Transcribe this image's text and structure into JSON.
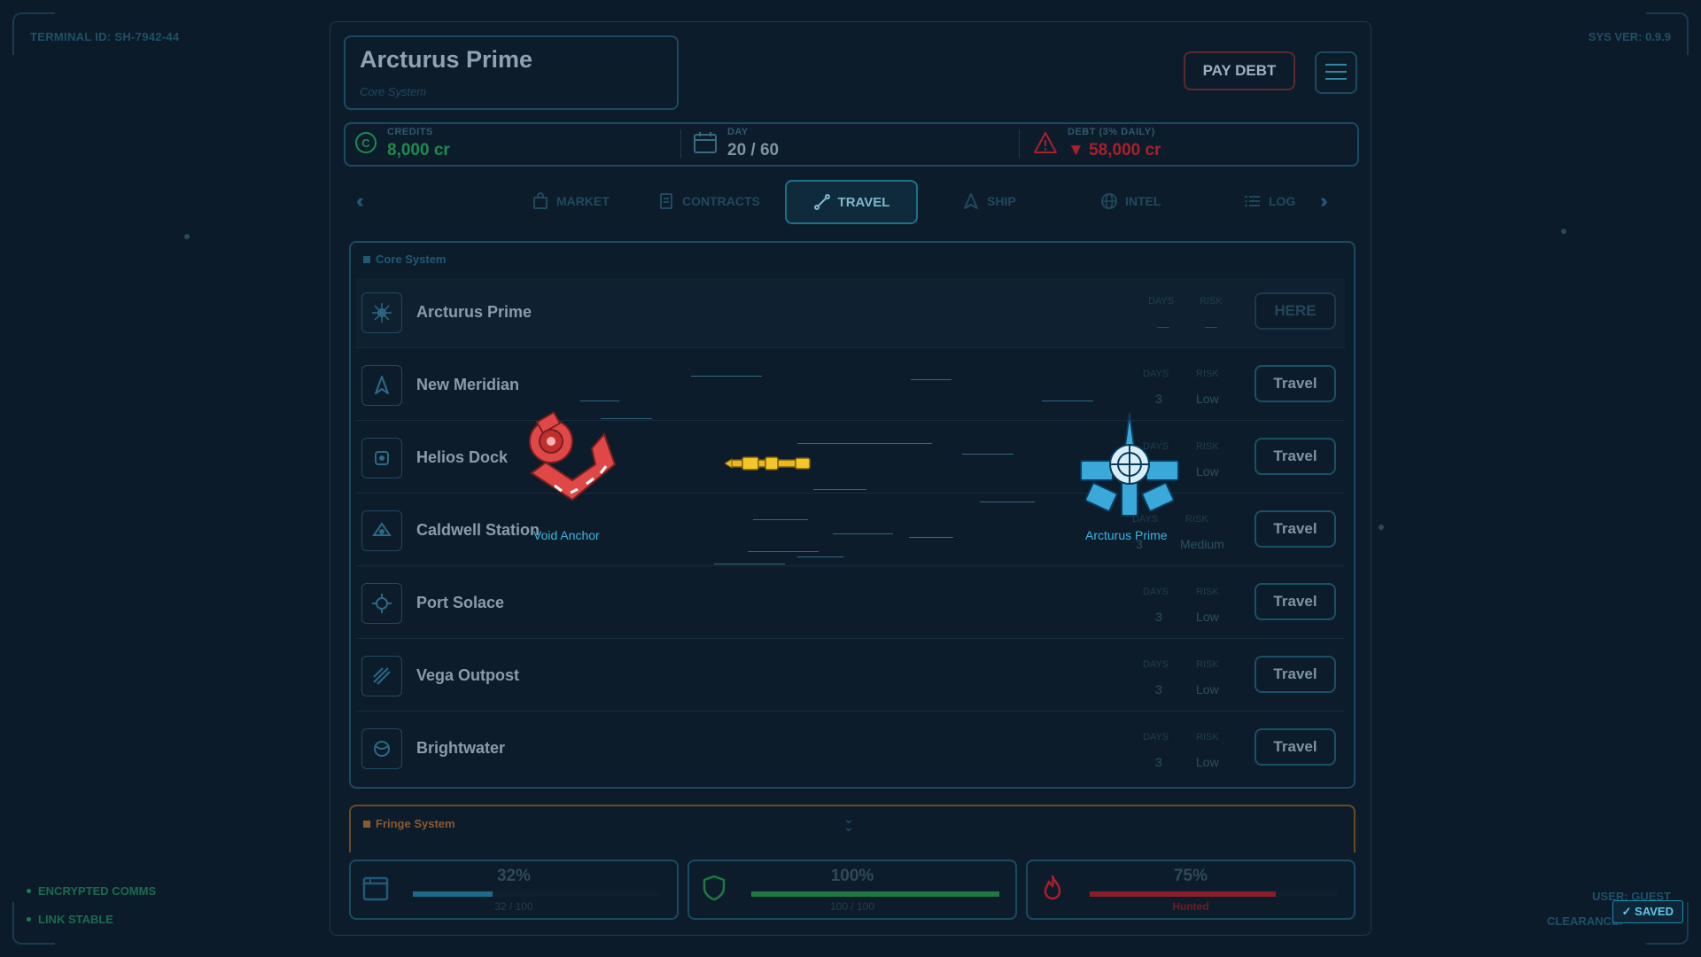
{
  "hud": {
    "terminal_id": "TERMINAL ID: SH-7942-44",
    "sys_ver": "SYS VER: 0.9.9",
    "status": [
      "ENCRYPTED COMMS",
      "LINK STABLE"
    ],
    "user": "USER: GUEST",
    "clearance": "CLEARANCE:",
    "saved": "✓ SAVED"
  },
  "header": {
    "location_name": "Arcturus Prime",
    "location_system": "Core System",
    "pay_debt": "PAY DEBT"
  },
  "stats": {
    "credits_label": "CREDITS",
    "credits_value": "8,000 cr",
    "day_label": "DAY",
    "day_value": "20 / 60",
    "debt_label": "DEBT (3% DAILY)",
    "debt_value": "▼ 58,000 cr"
  },
  "tabs": {
    "market": "MARKET",
    "contracts": "CONTRACTS",
    "travel": "TRAVEL",
    "ship": "SHIP",
    "intel": "INTEL",
    "log": "LOG",
    "active": "travel"
  },
  "core_system": {
    "title": "Core System",
    "days_label": "DAYS",
    "risk_label": "RISK",
    "destinations": [
      {
        "name": "Arcturus Prime",
        "days": "—",
        "risk": "—",
        "action": "HERE"
      },
      {
        "name": "New Meridian",
        "days": "3",
        "risk": "Low",
        "action": "Travel"
      },
      {
        "name": "Helios Dock",
        "days": "3",
        "risk": "Low",
        "action": "Travel"
      },
      {
        "name": "Caldwell Station",
        "days": "3",
        "risk": "Medium",
        "action": "Travel"
      },
      {
        "name": "Port Solace",
        "days": "3",
        "risk": "Low",
        "action": "Travel"
      },
      {
        "name": "Vega Outpost",
        "days": "3",
        "risk": "Low",
        "action": "Travel"
      },
      {
        "name": "Brightwater",
        "days": "3",
        "risk": "Low",
        "action": "Travel"
      }
    ]
  },
  "fringe_system": {
    "title": "Fringe System"
  },
  "gauges": {
    "cargo": {
      "percent": "32%",
      "detail": "32 / 100",
      "fraction": 0.32
    },
    "hull": {
      "percent": "100%",
      "detail": "100 / 100",
      "fraction": 1.0
    },
    "heat": {
      "percent": "75%",
      "detail": "Hunted",
      "fraction": 0.75
    }
  },
  "travel_animation": {
    "origin": "Void Anchor",
    "destination": "Arcturus Prime"
  },
  "colors": {
    "credits": "#1f8a4c",
    "debt": "#a8202a",
    "accent": "#39b6e2",
    "cargo_bar": "#1e6a8a",
    "hull_bar": "#1e7a3e",
    "heat_bar": "#8a1e28"
  }
}
